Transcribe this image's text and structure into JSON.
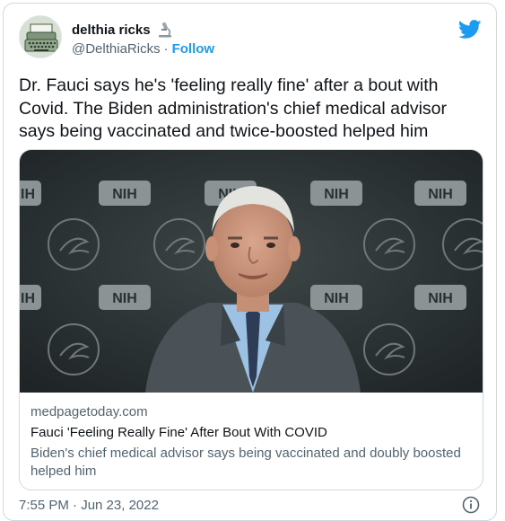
{
  "tweet": {
    "display_name": "delthia ricks",
    "name_emoji": "microscope-icon",
    "handle": "@DelthiaRicks",
    "separator": "·",
    "follow_label": "Follow",
    "text": "Dr. Fauci says he's 'feeling really fine' after a bout with\nCovid. The Biden administration's chief medical advisor\nsays being vaccinated and twice-boosted helped him",
    "timestamp": "7:55 PM · Jun 23, 2022"
  },
  "link_card": {
    "domain": "medpagetoday.com",
    "title": "Fauci 'Feeling Really Fine' After Bout With COVID",
    "description": "Biden's chief medical advisor says being vaccinated and doubly boosted helped him",
    "backdrop_logo": "NIH"
  },
  "icons": {
    "brand": "twitter-bird-icon",
    "info": "info-icon"
  },
  "colors": {
    "accent": "#1d9bf0",
    "text": "#0f1419",
    "muted": "#536471",
    "border": "#cfd9de"
  }
}
